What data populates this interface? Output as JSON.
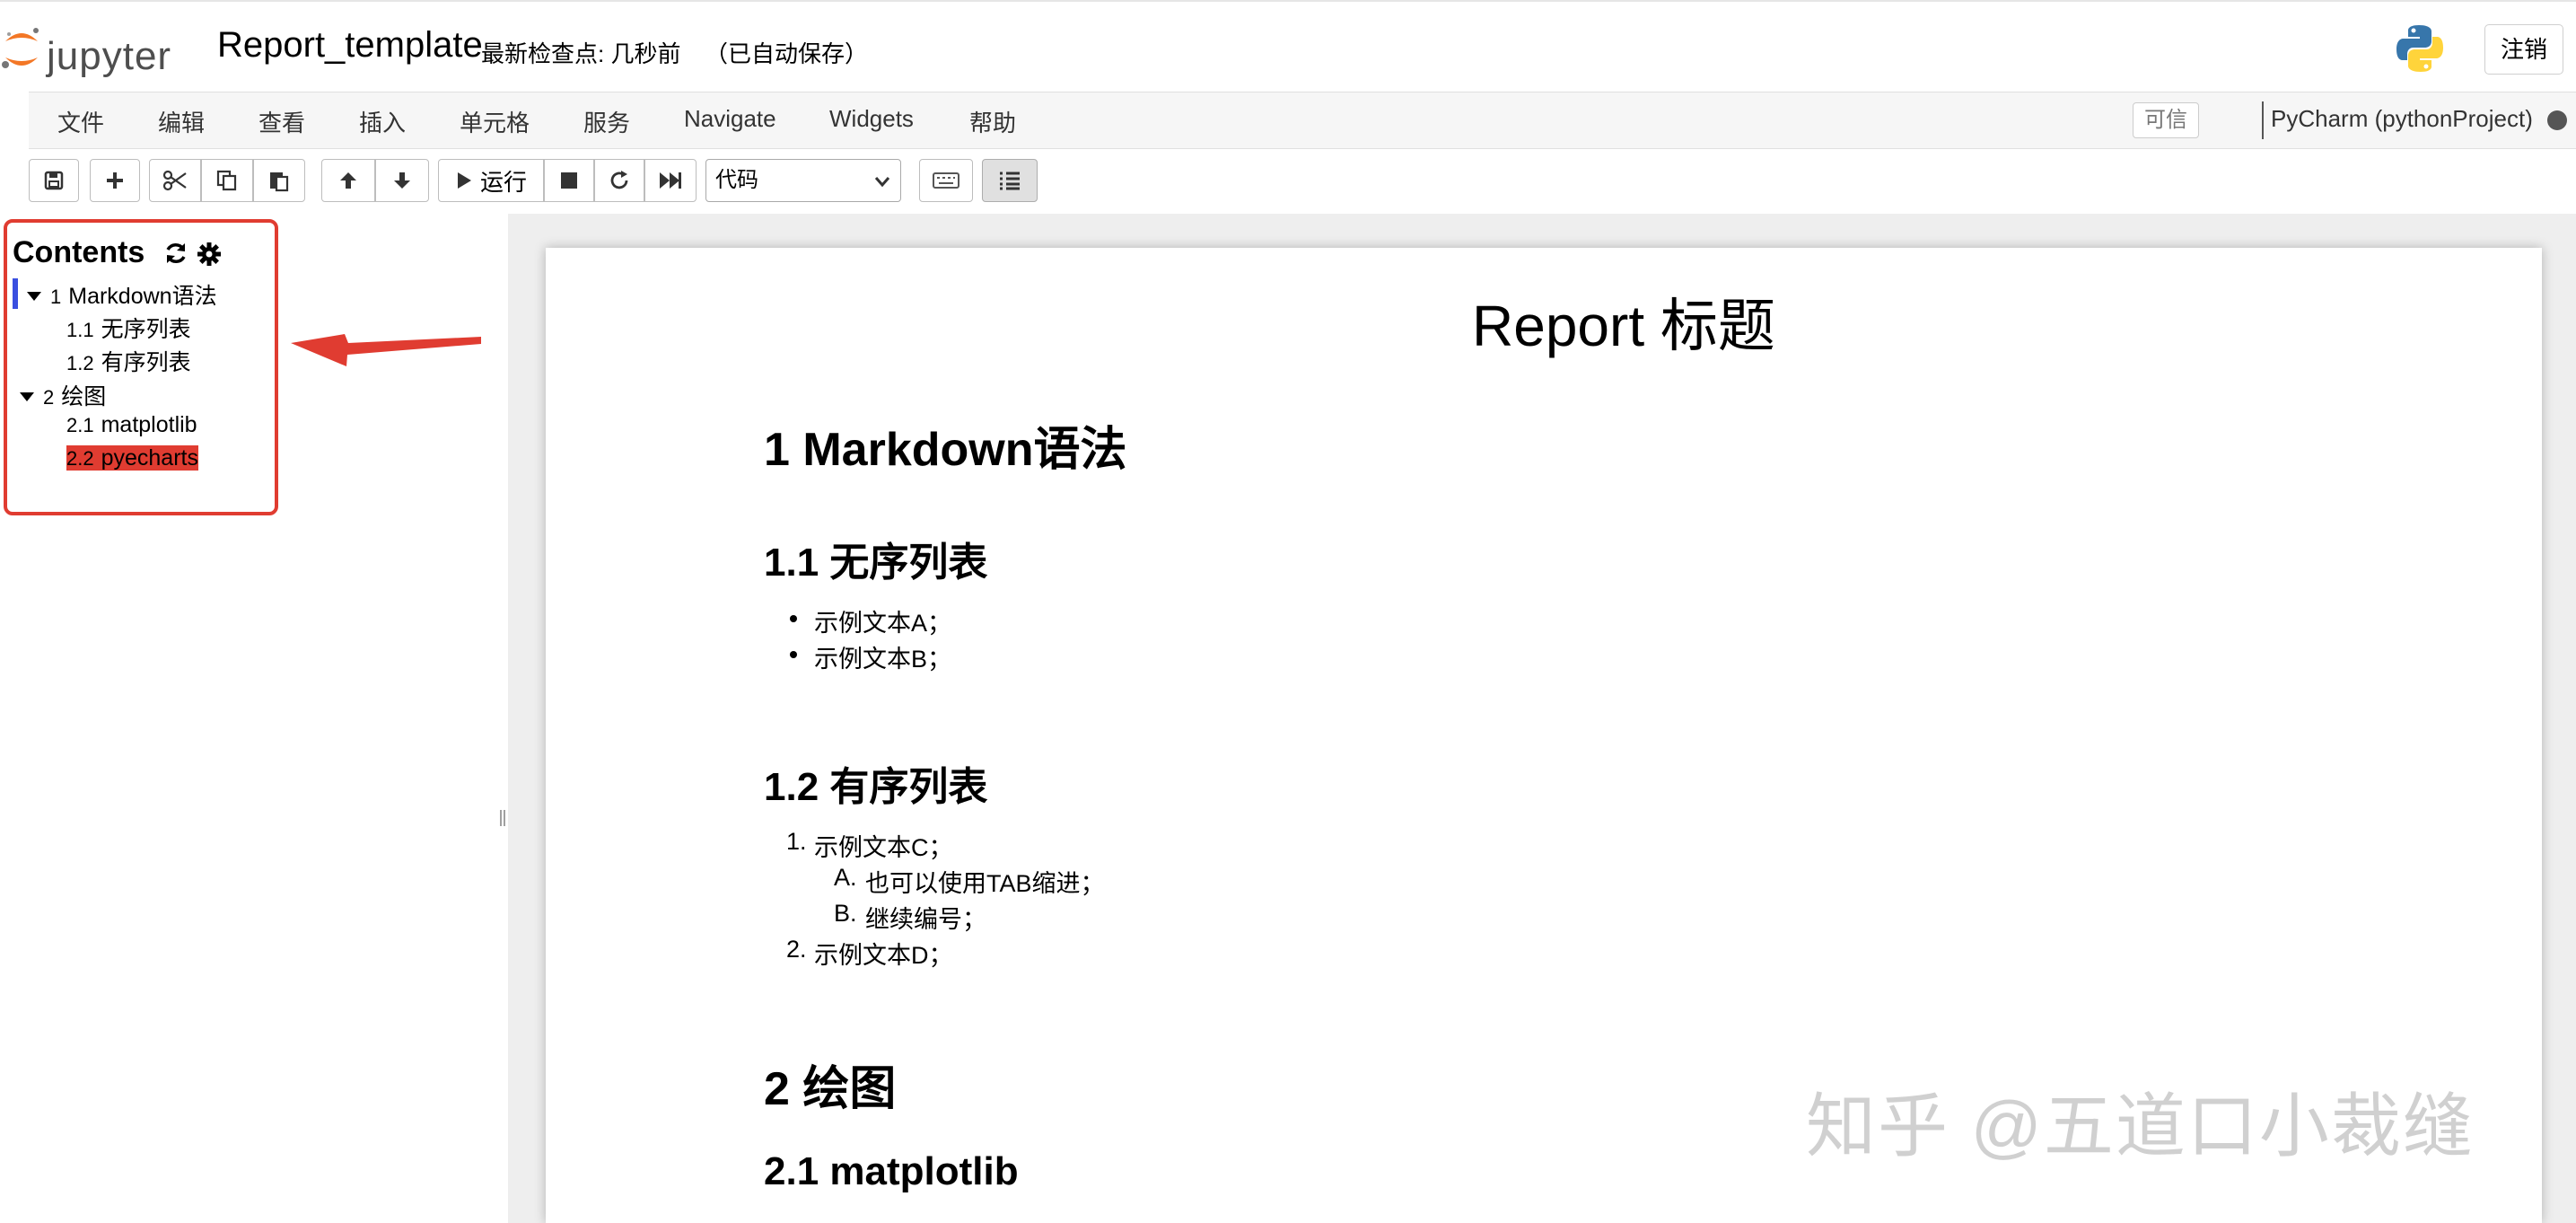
{
  "header": {
    "logo_text": "jupyter",
    "notebook_name": "Report_template",
    "checkpoint": "最新检查点: 几秒前",
    "autosave": "（已自动保存）",
    "logout": "注销"
  },
  "menubar": {
    "items": [
      "文件",
      "编辑",
      "查看",
      "插入",
      "单元格",
      "服务",
      "Navigate",
      "Widgets",
      "帮助"
    ],
    "trusted": "可信",
    "kernel": "PyCharm (pythonProject)"
  },
  "toolbar": {
    "run_label": "运行",
    "cell_type": "代码",
    "icons": [
      "save-icon",
      "plus-icon",
      "cut-icon",
      "copy-icon",
      "paste-icon",
      "arrow-up-icon",
      "arrow-down-icon",
      "play-icon",
      "stop-icon",
      "restart-icon",
      "fast-forward-icon",
      "keyboard-icon",
      "list-icon"
    ]
  },
  "toc": {
    "title": "Contents",
    "items": [
      {
        "num": "1",
        "label": "Markdown语法",
        "level": 1
      },
      {
        "num": "1.1",
        "label": "无序列表",
        "level": 2
      },
      {
        "num": "1.2",
        "label": "有序列表",
        "level": 2
      },
      {
        "num": "2",
        "label": "绘图",
        "level": 1
      },
      {
        "num": "2.1",
        "label": "matplotlib",
        "level": 2
      },
      {
        "num": "2.2",
        "label": "pyecharts",
        "level": 2
      }
    ]
  },
  "notebook": {
    "title": "Report 标题",
    "h1_markdown": "1  Markdown语法",
    "h2_unordered": "1.1  无序列表",
    "unordered": [
      "示例文本A；",
      "示例文本B；"
    ],
    "h2_ordered": "1.2  有序列表",
    "ordered": [
      {
        "marker": "1.",
        "text": "示例文本C；"
      },
      {
        "marker": "A.",
        "text": "也可以使用TAB缩进；"
      },
      {
        "marker": "B.",
        "text": "继续编号；"
      },
      {
        "marker": "2.",
        "text": "示例文本D；"
      }
    ],
    "h1_plot": "2  绘图",
    "h2_matplotlib": "2.1  matplotlib"
  },
  "watermark": "知乎 @五道口小裁缝",
  "colors": {
    "accent_red": "#e03c31",
    "toc_current": "#3a4fe0",
    "jupyter_orange": "#f37726"
  }
}
